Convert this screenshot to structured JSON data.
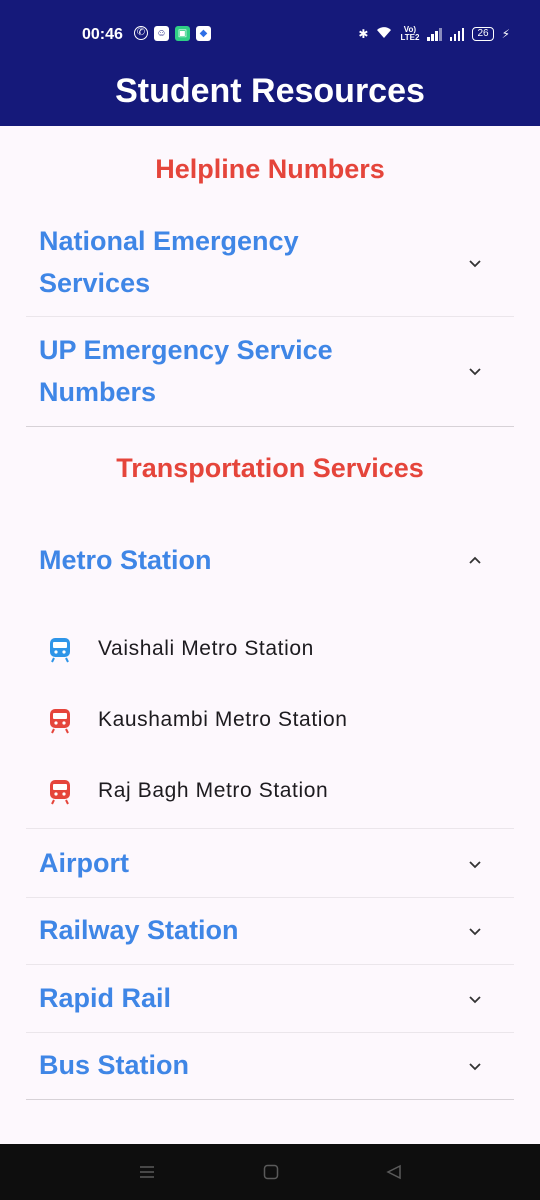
{
  "status_bar": {
    "time": "00:46",
    "battery": "26",
    "volte_top": "Vo)",
    "volte_bottom": "LTE2"
  },
  "app_bar": {
    "title": "Student Resources"
  },
  "sections": {
    "helpline": "Helpline Numbers",
    "transport": "Transportation Services"
  },
  "helpline_tiles": [
    {
      "line1": "National Emergency",
      "line2": "Services"
    },
    {
      "line1": "UP Emergency Service",
      "line2": "Numbers"
    }
  ],
  "transport_tiles": {
    "metro": "Metro Station",
    "airport": "Airport",
    "railway": "Railway Station",
    "rapid_rail": "Rapid Rail",
    "bus": "Bus Station"
  },
  "metro_stations": [
    {
      "label": "Vaishali Metro Station",
      "icon": "train-icon",
      "color": "#2e95e8"
    },
    {
      "label": "Kaushambi Metro Station",
      "icon": "train-icon",
      "color": "#e5453b"
    },
    {
      "label": "Raj Bagh Metro Station",
      "icon": "train-icon",
      "color": "#e5453b"
    }
  ],
  "colors": {
    "app_bar": "#15197a",
    "section_heading": "#e5453b",
    "tile_title": "#3f86e6",
    "background": "#fdf8fd"
  }
}
